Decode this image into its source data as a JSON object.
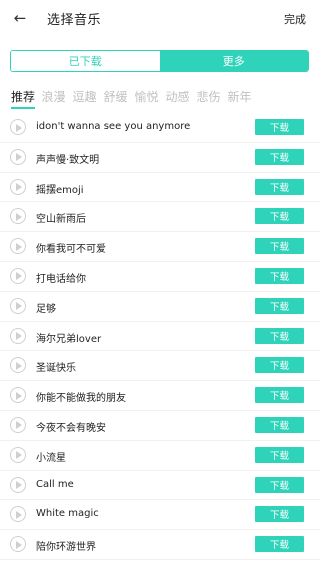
{
  "header": {
    "back_icon": "←",
    "title": "选择音乐",
    "done_label": "完成"
  },
  "segment": {
    "downloaded_label": "已下载",
    "more_label": "更多",
    "active": "更多",
    "accent_color": "#2fd3b9"
  },
  "tabs": [
    {
      "label": "推荐",
      "active": true
    },
    {
      "label": "浪漫"
    },
    {
      "label": "逗趣"
    },
    {
      "label": "舒缓"
    },
    {
      "label": "愉悦"
    },
    {
      "label": "动感"
    },
    {
      "label": "悲伤"
    },
    {
      "label": "新年"
    }
  ],
  "download_label": "下载",
  "songs": [
    "idon't wanna see you anymore",
    "声声慢·致文明",
    "摇摆emoji",
    "空山新雨后",
    "你看我可不可爱",
    "打电话给你",
    "足够",
    "海尔兄弟lover",
    "圣诞快乐",
    "你能不能做我的朋友",
    "今夜不会有晚安",
    "小流星",
    "Call me",
    "White magic",
    "陪你环游世界"
  ]
}
